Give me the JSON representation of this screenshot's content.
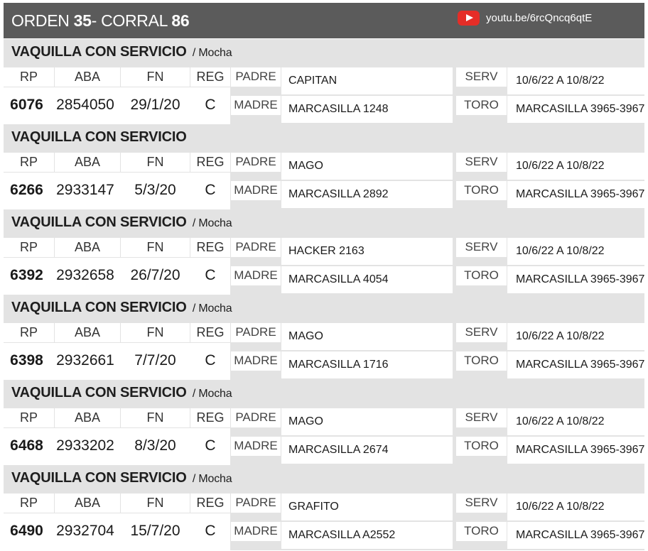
{
  "header": {
    "orden_label": "ORDEN",
    "orden_num": "35",
    "corral_label": "- CORRAL",
    "corral_num": "86",
    "video_url": "youtu.be/6rcQncq6qtE"
  },
  "columns": {
    "rp": "RP",
    "aba": "ABA",
    "fn": "FN",
    "reg": "REG"
  },
  "labels": {
    "padre": "PADRE",
    "madre": "MADRE",
    "serv": "SERV",
    "toro": "TORO"
  },
  "records": [
    {
      "title": "VAQUILLA CON SERVICIO",
      "subtitle": "/ Mocha",
      "rp": "6076",
      "aba": "2854050",
      "fn": "29/1/20",
      "reg": "C",
      "padre": "CAPITAN",
      "madre": "MARCASILLA 1248",
      "serv": "10/6/22 A 10/8/22",
      "toro": "MARCASILLA 3965-3967"
    },
    {
      "title": "VAQUILLA CON SERVICIO",
      "subtitle": "",
      "rp": "6266",
      "aba": "2933147",
      "fn": "5/3/20",
      "reg": "C",
      "padre": "MAGO",
      "madre": "MARCASILLA 2892",
      "serv": "10/6/22 A 10/8/22",
      "toro": "MARCASILLA 3965-3967"
    },
    {
      "title": "VAQUILLA CON SERVICIO",
      "subtitle": "/ Mocha",
      "rp": "6392",
      "aba": "2932658",
      "fn": "26/7/20",
      "reg": "C",
      "padre": "HACKER 2163",
      "madre": "MARCASILLA 4054",
      "serv": "10/6/22 A 10/8/22",
      "toro": "MARCASILLA 3965-3967"
    },
    {
      "title": "VAQUILLA CON SERVICIO",
      "subtitle": "/ Mocha",
      "rp": "6398",
      "aba": "2932661",
      "fn": "7/7/20",
      "reg": "C",
      "padre": "MAGO",
      "madre": "MARCASILLA 1716",
      "serv": "10/6/22 A 10/8/22",
      "toro": "MARCASILLA 3965-3967"
    },
    {
      "title": "VAQUILLA CON SERVICIO",
      "subtitle": "/ Mocha",
      "rp": "6468",
      "aba": "2933202",
      "fn": "8/3/20",
      "reg": "C",
      "padre": "MAGO",
      "madre": "MARCASILLA 2674",
      "serv": "10/6/22 A 10/8/22",
      "toro": "MARCASILLA 3965-3967"
    },
    {
      "title": "VAQUILLA CON SERVICIO",
      "subtitle": "/ Mocha",
      "rp": "6490",
      "aba": "2932704",
      "fn": "15/7/20",
      "reg": "C",
      "padre": "GRAFITO",
      "madre": "MARCASILLA A2552",
      "serv": "10/6/22 A 10/8/22",
      "toro": "MARCASILLA 3965-3967"
    }
  ]
}
